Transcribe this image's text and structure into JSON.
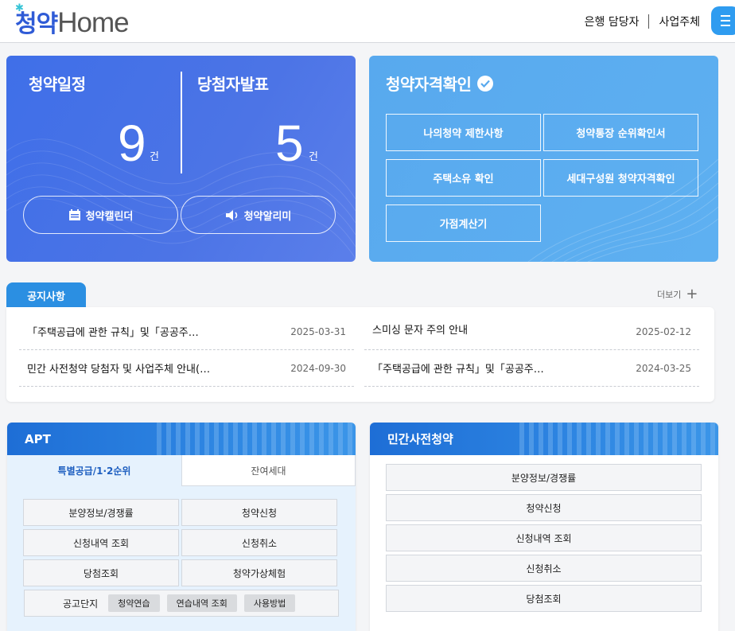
{
  "header": {
    "logo_kr": "청약",
    "logo_en": "Home",
    "links": [
      "은행 담당자",
      "사업주체"
    ],
    "menu_icon": "hamburger-menu-icon"
  },
  "schedule": {
    "title": "청약일정",
    "count": "9",
    "unit": "건"
  },
  "winners": {
    "title": "당첨자발표",
    "count": "5",
    "unit": "건"
  },
  "pills": {
    "calendar": "청약캘린더",
    "alarm": "청약알리미"
  },
  "qualification": {
    "title": "청약자격확인",
    "buttons": [
      "나의청약 제한사항",
      "청약통장 순위확인서",
      "주택소유 확인",
      "세대구성원 청약자격확인",
      "가점계산기"
    ]
  },
  "notice": {
    "tab": "공지사항",
    "more": "더보기",
    "items": [
      {
        "title": "「주택공급에 관한 규칙」및「공공주…",
        "date": "2025-03-31"
      },
      {
        "title": "스미싱 문자 주의 안내",
        "date": "2025-02-12"
      },
      {
        "title": "민간 사전청약 당첨자 및 사업주체 안내(…",
        "date": "2024-09-30"
      },
      {
        "title": "「주택공급에 관한 규칙」및「공공주…",
        "date": "2024-03-25"
      }
    ]
  },
  "apt": {
    "title": "APT",
    "tabs": [
      "특별공급/1·2순위",
      "잔여세대"
    ],
    "buttons": [
      "분양정보/경쟁률",
      "청약신청",
      "신청내역 조회",
      "신청취소",
      "당첨조회",
      "청약가상체험"
    ],
    "gongo": {
      "label": "공고단지",
      "chips": [
        "청약연습",
        "연습내역 조회",
        "사용방법"
      ]
    }
  },
  "private": {
    "title": "민간사전청약",
    "buttons": [
      "분양정보/경쟁률",
      "청약신청",
      "신청내역 조회",
      "신청취소",
      "당첨조회"
    ]
  }
}
